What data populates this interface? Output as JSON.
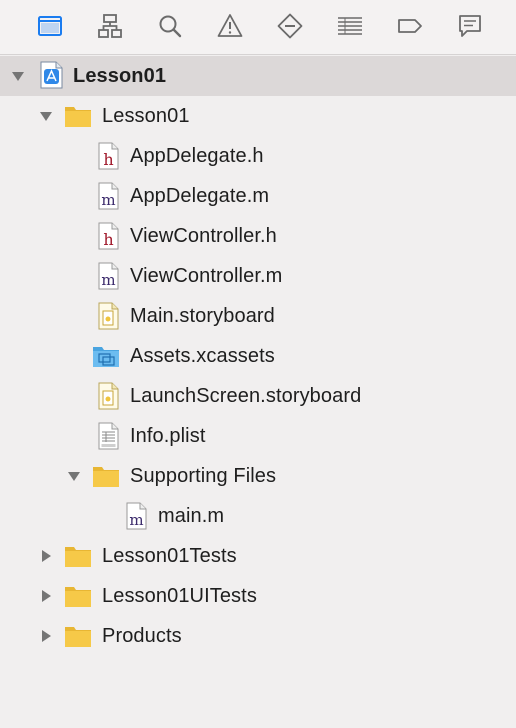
{
  "toolbar": {
    "icons": [
      {
        "name": "project-navigator-icon",
        "active": true
      },
      {
        "name": "symbol-navigator-icon",
        "active": false
      },
      {
        "name": "find-navigator-icon",
        "active": false
      },
      {
        "name": "issue-navigator-icon",
        "active": false
      },
      {
        "name": "test-navigator-icon",
        "active": false
      },
      {
        "name": "debug-navigator-icon",
        "active": false
      },
      {
        "name": "breakpoint-navigator-icon",
        "active": false
      },
      {
        "name": "report-navigator-icon",
        "active": false
      }
    ],
    "active_color": "#1a7cf0",
    "inactive_color": "#6b6b6b"
  },
  "tree": {
    "project": {
      "label": "Lesson01",
      "expanded": true,
      "icon": "xcode-project-icon"
    },
    "group_main": {
      "label": "Lesson01",
      "expanded": true,
      "icon": "folder-icon"
    },
    "files": [
      {
        "label": "AppDelegate.h",
        "icon": "header-file-icon"
      },
      {
        "label": "AppDelegate.m",
        "icon": "objc-file-icon"
      },
      {
        "label": "ViewController.h",
        "icon": "header-file-icon"
      },
      {
        "label": "ViewController.m",
        "icon": "objc-file-icon"
      },
      {
        "label": "Main.storyboard",
        "icon": "storyboard-file-icon"
      },
      {
        "label": "Assets.xcassets",
        "icon": "asset-catalog-icon"
      },
      {
        "label": "LaunchScreen.storyboard",
        "icon": "storyboard-file-icon"
      },
      {
        "label": "Info.plist",
        "icon": "plist-file-icon"
      }
    ],
    "supporting": {
      "label": "Supporting Files",
      "expanded": true,
      "icon": "folder-icon"
    },
    "supporting_files": [
      {
        "label": "main.m",
        "icon": "objc-file-icon"
      }
    ],
    "groups": [
      {
        "label": "Lesson01Tests",
        "expanded": false,
        "icon": "folder-icon"
      },
      {
        "label": "Lesson01UITests",
        "expanded": false,
        "icon": "folder-icon"
      },
      {
        "label": "Products",
        "expanded": false,
        "icon": "folder-icon"
      }
    ]
  },
  "colors": {
    "folder": "#f6c948",
    "header_letter": "#a0182a",
    "objc_letter": "#3b2a6b",
    "selected_row": "#dcd8d8"
  }
}
